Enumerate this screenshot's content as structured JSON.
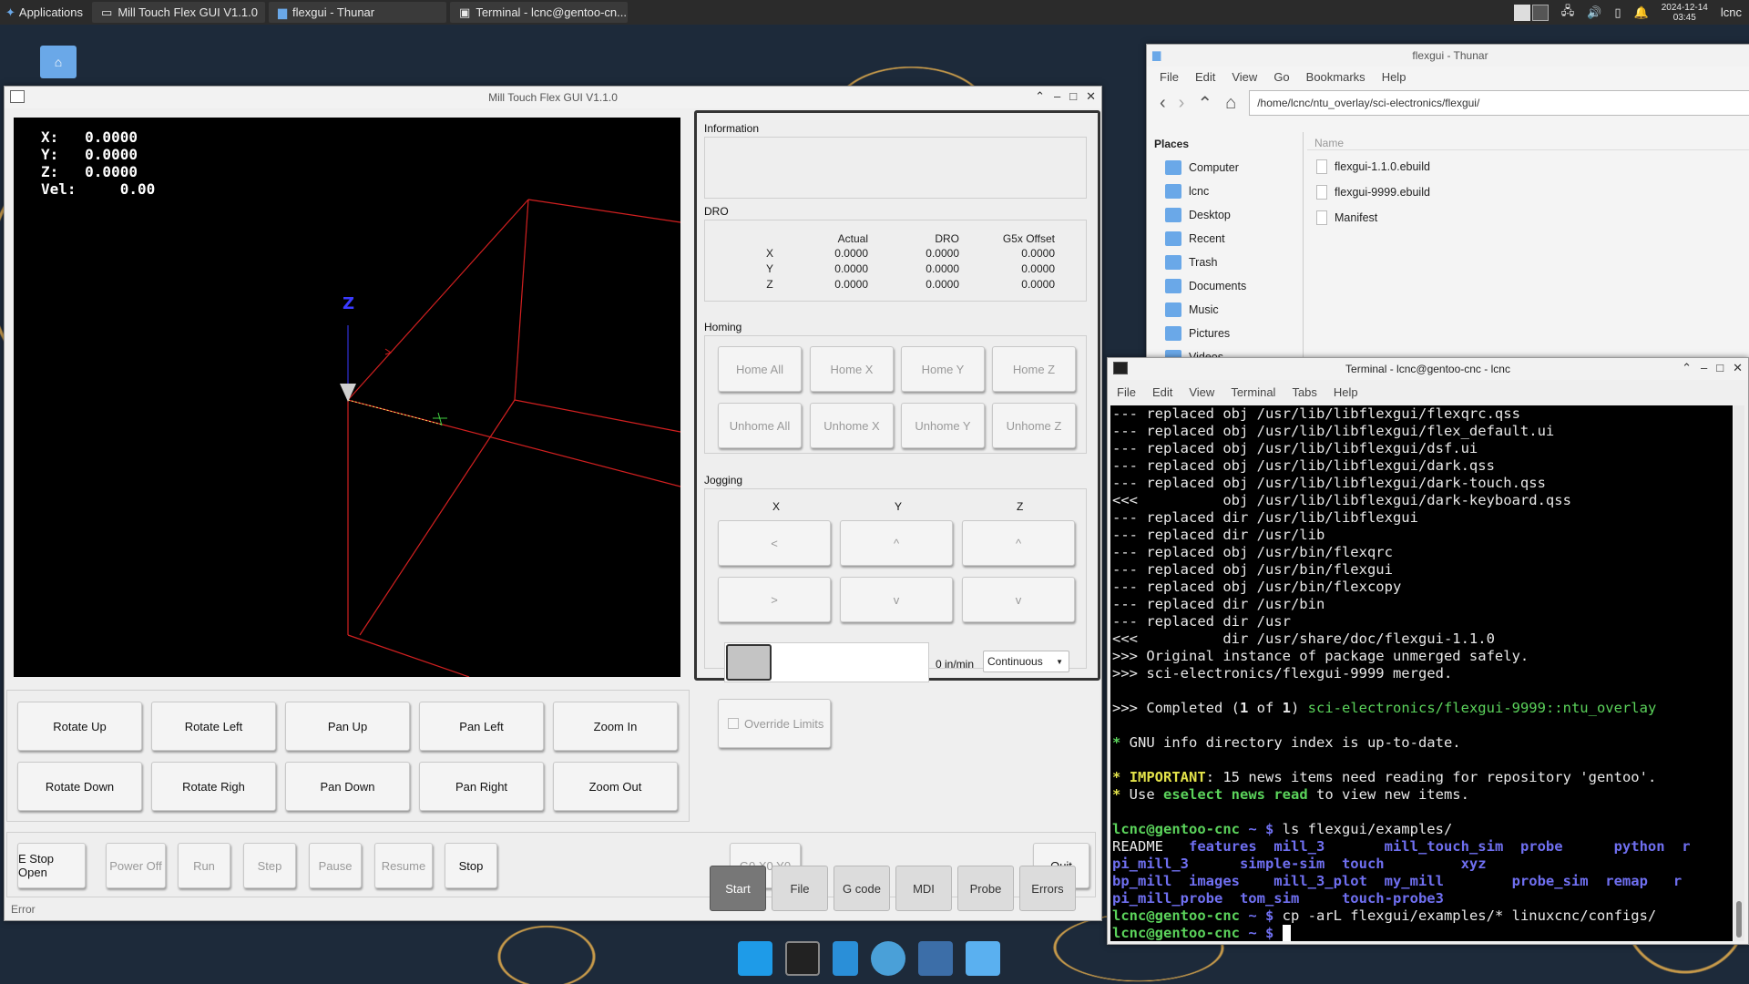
{
  "top_panel": {
    "applications": "Applications",
    "tasks": [
      "Mill Touch Flex GUI V1.1.0",
      "flexgui - Thunar",
      "Terminal - lcnc@gentoo-cn..."
    ],
    "date": "2024-12-14",
    "time": "03:45",
    "user": "lcnc"
  },
  "gui": {
    "title": "Mill Touch Flex GUI V1.1.0",
    "viewport": {
      "x": "X:   0.0000",
      "y": "Y:   0.0000",
      "z": "Z:   0.0000",
      "vel": "Vel:     0.00",
      "axis_label": "Z"
    },
    "view_buttons": [
      "Rotate Up",
      "Rotate Left",
      "Pan Up",
      "Pan Left",
      "Zoom In",
      "Rotate Down",
      "Rotate Righ",
      "Pan Down",
      "Pan Right",
      "Zoom Out"
    ],
    "bottom_buttons": {
      "estop": "E Stop Open",
      "power": "Power Off",
      "run": "Run",
      "step": "Step",
      "pause": "Pause",
      "resume": "Resume",
      "stop": "Stop",
      "g0": "G0 X0 Y0",
      "quit": "Quit"
    },
    "status": "Error",
    "information_label": "Information",
    "dro": {
      "label": "DRO",
      "headers": [
        "Actual",
        "DRO",
        "G5x Offset"
      ],
      "rows": [
        {
          "axis": "X",
          "actual": "0.0000",
          "dro": "0.0000",
          "offset": "0.0000"
        },
        {
          "axis": "Y",
          "actual": "0.0000",
          "dro": "0.0000",
          "offset": "0.0000"
        },
        {
          "axis": "Z",
          "actual": "0.0000",
          "dro": "0.0000",
          "offset": "0.0000"
        }
      ]
    },
    "homing": {
      "label": "Homing",
      "buttons": [
        "Home All",
        "Home X",
        "Home Y",
        "Home Z",
        "Unhome All",
        "Unhome X",
        "Unhome Y",
        "Unhome Z"
      ]
    },
    "jogging": {
      "label": "Jogging",
      "axes": [
        "X",
        "Y",
        "Z"
      ],
      "row1": [
        "<",
        "^",
        "^"
      ],
      "row2": [
        ">",
        "v",
        "v"
      ],
      "speed": "0 in/min",
      "mode": "Continuous",
      "override": "Override Limits"
    },
    "tabs": [
      "Start",
      "File",
      "G code",
      "MDI",
      "Probe",
      "Errors"
    ]
  },
  "thunar": {
    "title": "flexgui - Thunar",
    "menu": [
      "File",
      "Edit",
      "View",
      "Go",
      "Bookmarks",
      "Help"
    ],
    "path": "/home/lcnc/ntu_overlay/sci-electronics/flexgui/",
    "places_label": "Places",
    "places": [
      "Computer",
      "lcnc",
      "Desktop",
      "Recent",
      "Trash",
      "Documents",
      "Music",
      "Pictures",
      "Videos"
    ],
    "name_header": "Name",
    "files": [
      "flexgui-1.1.0.ebuild",
      "flexgui-9999.ebuild",
      "Manifest"
    ]
  },
  "terminal": {
    "title": "Terminal - lcnc@gentoo-cnc - lcnc",
    "menu": [
      "File",
      "Edit",
      "View",
      "Terminal",
      "Tabs",
      "Help"
    ],
    "lines": [
      "--- replaced obj /usr/lib/libflexgui/flexqrc.qss",
      "--- replaced obj /usr/lib/libflexgui/flex_default.ui",
      "--- replaced obj /usr/lib/libflexgui/dsf.ui",
      "--- replaced obj /usr/lib/libflexgui/dark.qss",
      "--- replaced obj /usr/lib/libflexgui/dark-touch.qss",
      "<<<          obj /usr/lib/libflexgui/dark-keyboard.qss",
      "--- replaced dir /usr/lib/libflexgui",
      "--- replaced dir /usr/lib",
      "--- replaced obj /usr/bin/flexqrc",
      "--- replaced obj /usr/bin/flexgui",
      "--- replaced obj /usr/bin/flexcopy",
      "--- replaced dir /usr/bin",
      "--- replaced dir /usr",
      "<<<          dir /usr/share/doc/flexgui-1.1.0",
      ">>> Original instance of package unmerged safely.",
      ">>> sci-electronics/flexgui-9999 merged."
    ],
    "completed_prefix": ">>> Completed (",
    "completed_n": "1",
    "completed_of": " of ",
    "completed_m": "1",
    "completed_close": ") ",
    "completed_pkg": "sci-electronics/flexgui-9999::ntu_overlay",
    "info_line": " GNU info directory index is up-to-date.",
    "important_label": "IMPORTANT",
    "important_rest": ": 15 news items need reading for repository 'gentoo'.",
    "use_pre": " Use ",
    "use_cmd": "eselect news read",
    "use_post": " to view new items.",
    "prompt_user": "lcnc@gentoo-cnc",
    "prompt_dir": " ~ $ ",
    "cmd1": "ls flexgui/examples/",
    "ls_rows": [
      [
        "README   ",
        "features  mill_3       mill_touch_sim  probe      python  r"
      ],
      [
        "",
        "pi_mill_3      simple-sim  touch         xyz"
      ],
      [
        "",
        "bp_mill  images    mill_3_plot  my_mill        probe_sim  remap   r"
      ],
      [
        "",
        "pi_mill_probe  tom_sim     touch-probe3"
      ]
    ],
    "cmd2": "cp -arL flexgui/examples/* linuxcnc/configs/"
  },
  "colors": {
    "viewport_bg": "#000000",
    "box_red": "#d22020",
    "term_green": "#5bd35b",
    "term_blue": "#6f6ff0"
  }
}
